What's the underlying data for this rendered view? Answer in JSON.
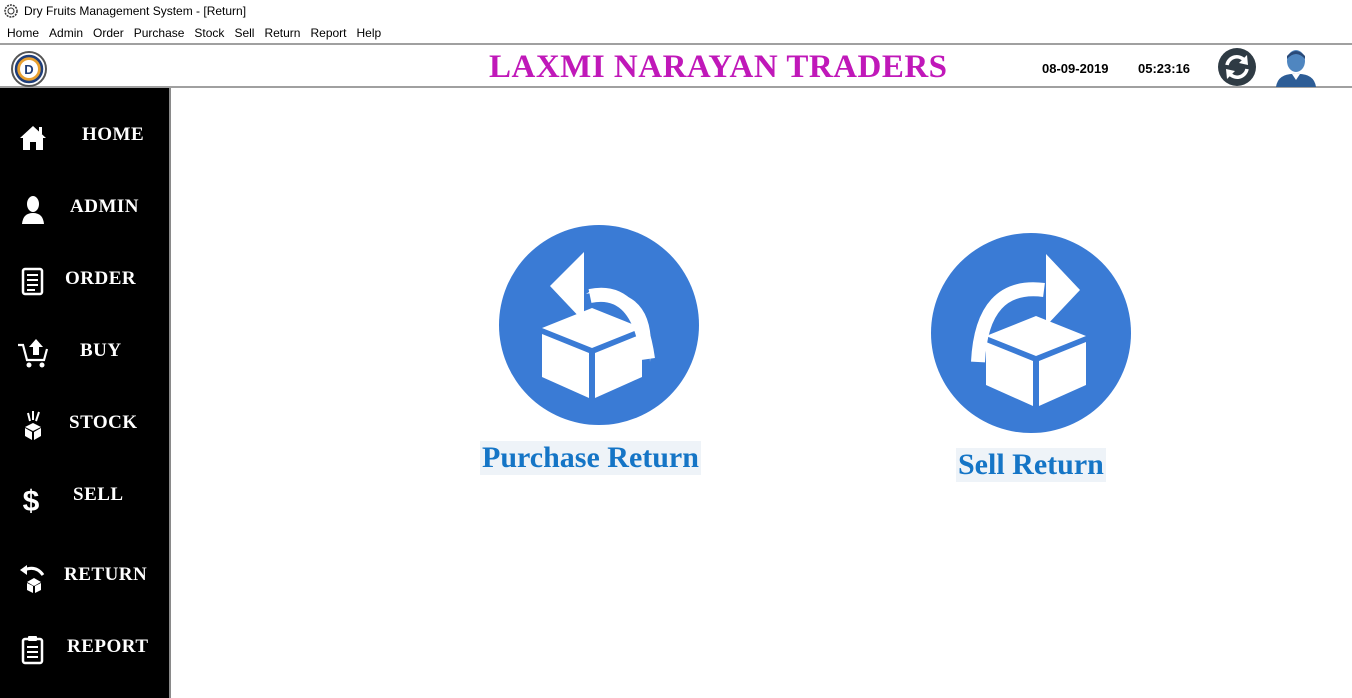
{
  "window": {
    "title": "Dry Fruits Management System - [Return]"
  },
  "menu": [
    "Home",
    "Admin",
    "Order",
    "Purchase",
    "Stock",
    "Sell",
    "Return",
    "Report",
    "Help"
  ],
  "header": {
    "brand": "LAXMI NARAYAN TRADERS",
    "date": "08-09-2019",
    "time": "05:23:16",
    "logo_letter": "D",
    "brand_color": "#c018b9"
  },
  "sidebar": {
    "items": [
      {
        "label": "HOME",
        "icon": "home-icon"
      },
      {
        "label": "ADMIN",
        "icon": "user-icon"
      },
      {
        "label": "ORDER",
        "icon": "document-icon"
      },
      {
        "label": "BUY",
        "icon": "cart-icon"
      },
      {
        "label": "STOCK",
        "icon": "stock-box-icon"
      },
      {
        "label": "SELL",
        "icon": "dollar-icon"
      },
      {
        "label": "RETURN",
        "icon": "return-icon"
      },
      {
        "label": "REPORT",
        "icon": "clipboard-icon"
      }
    ]
  },
  "main": {
    "purchase_return": {
      "label": "Purchase Return",
      "icon": "purchase-return-icon"
    },
    "sell_return": {
      "label": "Sell Return",
      "icon": "sell-return-icon"
    },
    "accent": "#3a7bd5"
  }
}
